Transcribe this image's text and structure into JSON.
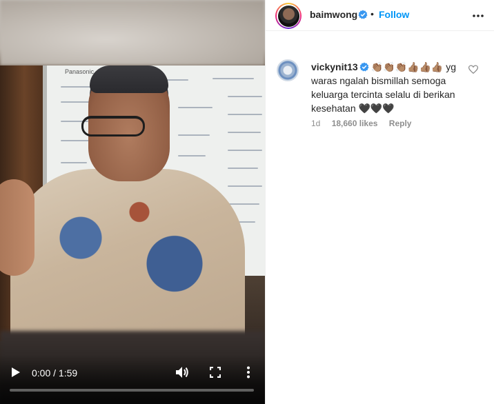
{
  "video": {
    "time_label": "0:00 / 1:59",
    "progress": 0
  },
  "header": {
    "username": "baimwong",
    "separator": "•",
    "follow_label": "Follow"
  },
  "comment": {
    "username": "vickynit13",
    "text": "👏🏽👏🏽👏🏽👍🏽👍🏽👍🏽 yg waras ngalah bismillah semoga keluarga tercinta selalu di berikan kesehatan 🖤🖤🖤",
    "age": "1d",
    "likes": "18,660 likes",
    "reply_label": "Reply"
  },
  "colors": {
    "accent": "#0095f6",
    "verified": "#3897f0",
    "muted": "#8e8e8e"
  },
  "icons": [
    "play-icon",
    "volume-icon",
    "fullscreen-icon",
    "more-vertical-icon",
    "verified-icon",
    "more-horizontal-icon",
    "heart-outline-icon"
  ]
}
